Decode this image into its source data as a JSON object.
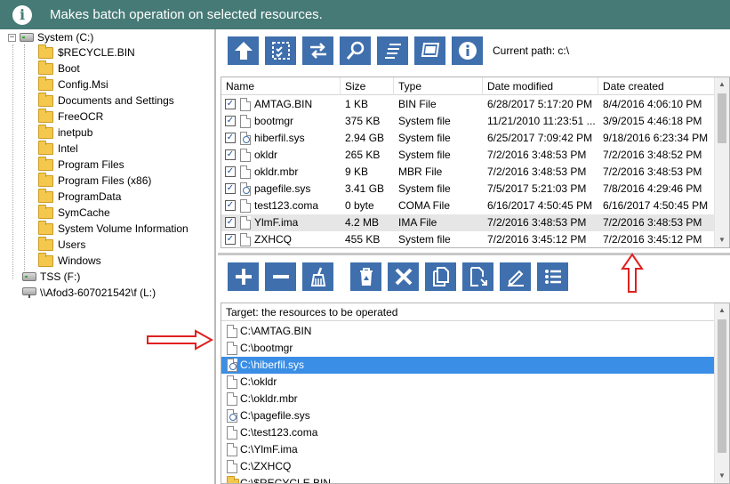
{
  "header": {
    "title": "Makes batch operation on selected resources."
  },
  "tree": {
    "root": "System (C:)",
    "folders": [
      "$RECYCLE.BIN",
      "Boot",
      "Config.Msi",
      "Documents and Settings",
      "FreeOCR",
      "inetpub",
      "Intel",
      "Program Files",
      "Program Files (x86)",
      "ProgramData",
      "SymCache",
      "System Volume Information",
      "Users",
      "Windows"
    ],
    "drive2": "TSS (F:)",
    "network": "\\\\Afod3-607021542\\f (L:)"
  },
  "toolbar": {
    "current_path": "Current path: c:\\"
  },
  "grid": {
    "columns": [
      "Name",
      "Size",
      "Type",
      "Date modified",
      "Date created"
    ],
    "rows": [
      {
        "name": "AMTAG.BIN",
        "size": "1 KB",
        "type": "BIN File",
        "modified": "6/28/2017 5:17:20 PM",
        "created": "8/4/2016 4:06:10 PM"
      },
      {
        "name": "bootmgr",
        "size": "375 KB",
        "type": "System file",
        "modified": "11/21/2010 11:23:51 ...",
        "created": "3/9/2015 4:46:18 PM"
      },
      {
        "name": "hiberfil.sys",
        "size": "2.94 GB",
        "type": "System file",
        "modified": "6/25/2017 7:09:42 PM",
        "created": "9/18/2016 6:23:34 PM"
      },
      {
        "name": "okldr",
        "size": "265 KB",
        "type": "System file",
        "modified": "7/2/2016 3:48:53 PM",
        "created": "7/2/2016 3:48:52 PM"
      },
      {
        "name": "okldr.mbr",
        "size": "9 KB",
        "type": "MBR File",
        "modified": "7/2/2016 3:48:53 PM",
        "created": "7/2/2016 3:48:53 PM"
      },
      {
        "name": "pagefile.sys",
        "size": "3.41 GB",
        "type": "System file",
        "modified": "7/5/2017 5:21:03 PM",
        "created": "7/8/2016 4:29:46 PM"
      },
      {
        "name": "test123.coma",
        "size": "0 byte",
        "type": "COMA File",
        "modified": "6/16/2017 4:50:45 PM",
        "created": "6/16/2017 4:50:45 PM"
      },
      {
        "name": "YlmF.ima",
        "size": "4.2 MB",
        "type": "IMA File",
        "modified": "7/2/2016 3:48:53 PM",
        "created": "7/2/2016 3:48:53 PM"
      },
      {
        "name": "ZXHCQ",
        "size": "455 KB",
        "type": "System file",
        "modified": "7/2/2016 3:45:12 PM",
        "created": "7/2/2016 3:45:12 PM"
      }
    ]
  },
  "target": {
    "header": "Target: the resources to be operated",
    "items": [
      "C:\\AMTAG.BIN",
      "C:\\bootmgr",
      "C:\\hiberfil.sys",
      "C:\\okldr",
      "C:\\okldr.mbr",
      "C:\\pagefile.sys",
      "C:\\test123.coma",
      "C:\\YlmF.ima",
      "C:\\ZXHCQ",
      "C:\\$RECYCLE.BIN"
    ]
  },
  "colors": {
    "header_bg": "#467a76",
    "button_bg": "#3f6fad",
    "selection": "#3a8ee6",
    "annotation": "#e02020"
  },
  "icons": {
    "toolbar_top": [
      "up-arrow-icon",
      "select-all-icon",
      "swap-icon",
      "search-icon",
      "list-icon",
      "screen-icon",
      "info-icon"
    ],
    "toolbar_bottom": [
      "plus-icon",
      "minus-icon",
      "broom-icon",
      "recycle-bin-icon",
      "delete-icon",
      "copy-icon",
      "move-icon",
      "rename-icon",
      "list-detail-icon"
    ]
  }
}
